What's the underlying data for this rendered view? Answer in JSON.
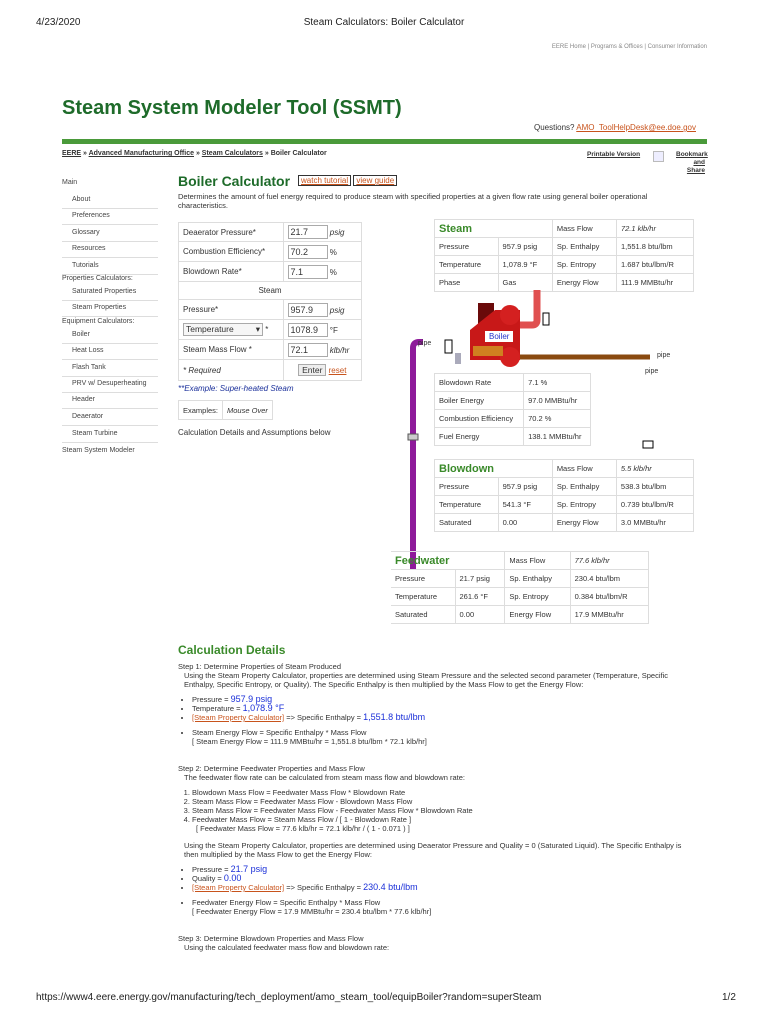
{
  "print_header": {
    "date": "4/23/2020",
    "title": "Steam Calculators: Boiler Calculator"
  },
  "top_links": [
    "EERE Home",
    "Programs & Offices",
    "Consumer Information"
  ],
  "site_title": "Steam System Modeler Tool (SSMT)",
  "questions": {
    "label": "Questions?",
    "email": "AMO_ToolHelpDesk@ee.doe.gov"
  },
  "breadcrumb": [
    "EERE",
    "Advanced Manufacturing Office",
    "Steam Calculators",
    "Boiler Calculator"
  ],
  "utility": {
    "printable": "Printable Version",
    "bookmark1": "Bookmark",
    "bookmark2": "and Share"
  },
  "sidebar": [
    {
      "label": "Main",
      "h": true
    },
    {
      "label": "About"
    },
    {
      "label": "Preferences"
    },
    {
      "label": "Glossary"
    },
    {
      "label": "Resources"
    },
    {
      "label": "Tutorials"
    },
    {
      "label": "Properties Calculators:",
      "h": true
    },
    {
      "label": "Saturated Properties"
    },
    {
      "label": "Steam Properties"
    },
    {
      "label": "Equipment Calculators:",
      "h": true
    },
    {
      "label": "Boiler"
    },
    {
      "label": "Heat Loss"
    },
    {
      "label": "Flash Tank"
    },
    {
      "label": "PRV w/ Desuperheating"
    },
    {
      "label": "Header"
    },
    {
      "label": "Deaerator"
    },
    {
      "label": "Steam Turbine"
    },
    {
      "label": "Steam System Modeler",
      "h": true
    }
  ],
  "calc": {
    "title": "Boiler Calculator",
    "watch": "watch tutorial",
    "guide": "view guide",
    "description": "Determines the amount of fuel energy required to produce steam with specified properties at a given flow rate using general boiler operational characteristics.",
    "form": {
      "deaerator_label": "Deaerator Pressure*",
      "deaerator": "21.7",
      "deaerator_unit": "psig",
      "eff_label": "Combustion Efficiency*",
      "eff": "70.2",
      "eff_unit": "%",
      "blowdown_label": "Blowdown Rate*",
      "blowdown": "7.1",
      "blowdown_unit": "%",
      "steam_header": "Steam",
      "pressure_label": "Pressure*",
      "pressure": "957.9",
      "pressure_unit": "psig",
      "second_param": "Temperature",
      "second_value": "1078.9",
      "second_unit": "°F",
      "flow_label": "Steam Mass Flow *",
      "flow": "72.1",
      "flow_unit": "klb/hr",
      "required": "* Required",
      "enter": "Enter",
      "reset": "reset"
    },
    "example": "**Example: Super-heated Steam",
    "examples_label": "Examples:",
    "examples_value": "Mouse Over",
    "below": "Calculation Details and Assumptions below"
  },
  "steam_table": {
    "title": "Steam",
    "rows": [
      [
        "Pressure",
        "957.9 psig",
        "Sp. Enthalpy",
        "1,551.8 btu/lbm"
      ],
      [
        "Temperature",
        "1,078.9 °F",
        "Sp. Entropy",
        "1.687 btu/lbm/R"
      ],
      [
        "Phase",
        "Gas",
        "Energy Flow",
        "111.9 MMBtu/hr"
      ]
    ],
    "mass_label": "Mass Flow",
    "mass": "72.1 klb/hr"
  },
  "boiler_label": "Boiler",
  "pipe_label": "pipe",
  "boiler_table": [
    [
      "Blowdown Rate",
      "7.1 %"
    ],
    [
      "Boiler Energy",
      "97.0 MMBtu/hr"
    ],
    [
      "Combustion Efficiency",
      "70.2 %"
    ],
    [
      "Fuel Energy",
      "138.1 MMBtu/hr"
    ]
  ],
  "blowdown_table": {
    "title": "Blowdown",
    "rows": [
      [
        "Pressure",
        "957.9 psig",
        "Sp. Enthalpy",
        "538.3 btu/lbm"
      ],
      [
        "Temperature",
        "541.3 °F",
        "Sp. Entropy",
        "0.739 btu/lbm/R"
      ],
      [
        "Saturated",
        "0.00",
        "Energy Flow",
        "3.0 MMBtu/hr"
      ]
    ],
    "mass_label": "Mass Flow",
    "mass": "5.5 klb/hr"
  },
  "feedwater_table": {
    "title": "Feedwater",
    "rows": [
      [
        "Pressure",
        "21.7 psig",
        "Sp. Enthalpy",
        "230.4 btu/lbm"
      ],
      [
        "Temperature",
        "261.6 °F",
        "Sp. Entropy",
        "0.384 btu/lbm/R"
      ],
      [
        "Saturated",
        "0.00",
        "Energy Flow",
        "17.9 MMBtu/hr"
      ]
    ],
    "mass_label": "Mass Flow",
    "mass": "77.6 klb/hr"
  },
  "details": {
    "title": "Calculation Details",
    "step1": "Step 1: Determine Properties of Steam Produced",
    "step1_text": "Using the Steam Property Calculator, properties are determined using Steam Pressure and the selected second parameter (Temperature, Specific Enthalpy, Specific Entropy, or Quality). The Specific Enthalpy is then multiplied by the Mass Flow to get the Energy Flow:",
    "s1_pressure": "Pressure = ",
    "s1_pressure_v": "957.9 psig",
    "s1_temp": "Temperature = ",
    "s1_temp_v": "1,078.9 °F",
    "spc": "[Steam Property Calculator]",
    "s1_enth": " => Specific Enthalpy = ",
    "s1_enth_v": "1,551.8 btu/lbm",
    "s1_formula": "Steam Energy Flow = Specific Enthalpy * Mass Flow",
    "s1_calc": "[ Steam Energy Flow = 111.9 MMBtu/hr = 1,551.8 btu/lbm * 72.1 klb/hr]",
    "step2": "Step 2: Determine Feedwater Properties and Mass Flow",
    "step2_text": "The feedwater flow rate can be calculated from steam mass flow and blowdown rate:",
    "s2_list": [
      "Blowdown Mass Flow = Feedwater Mass Flow * Blowdown Rate",
      "Steam Mass Flow = Feedwater Mass Flow - Blowdown Mass Flow",
      "Steam Mass Flow = Feedwater Mass Flow - Feedwater Mass Flow * Blowdown Rate",
      "Feedwater Mass Flow = Steam Mass Flow / [ 1 - Blowdown Rate ]"
    ],
    "s2_calc": "[ Feedwater Mass Flow = 77.6 klb/hr = 72.1 klb/hr / ( 1 - 0.071 ) ]",
    "s2_text2": "Using the Steam Property Calculator, properties are determined using Deaerator Pressure and Quality = 0 (Saturated Liquid). The Specific Enthalpy is then multiplied by the Mass Flow to get the Energy Flow:",
    "s2_pressure": "Pressure = ",
    "s2_pressure_v": "21.7 psig",
    "s2_quality": "Quality = ",
    "s2_quality_v": "0.00",
    "s2_enth_v": "230.4 btu/lbm",
    "s2_formula": "Feedwater Energy Flow = Specific Enthalpy * Mass Flow",
    "s2_calc2": "[ Feedwater Energy Flow = 17.9 MMBtu/hr = 230.4 btu/lbm * 77.6 klb/hr]",
    "step3": "Step 3: Determine Blowdown Properties and Mass Flow",
    "step3_text": "Using the calculated feedwater mass flow and blowdown rate:"
  },
  "footer": {
    "url": "https://www4.eere.energy.gov/manufacturing/tech_deployment/amo_steam_tool/equipBoiler?random=superSteam",
    "page": "1/2"
  },
  "colors": {
    "green": "#3a8a2a",
    "orange": "#c8531c",
    "blue": "#1a2fd8",
    "purple": "#8e1a9a",
    "red": "#d42020",
    "brown": "#8a4a10"
  }
}
